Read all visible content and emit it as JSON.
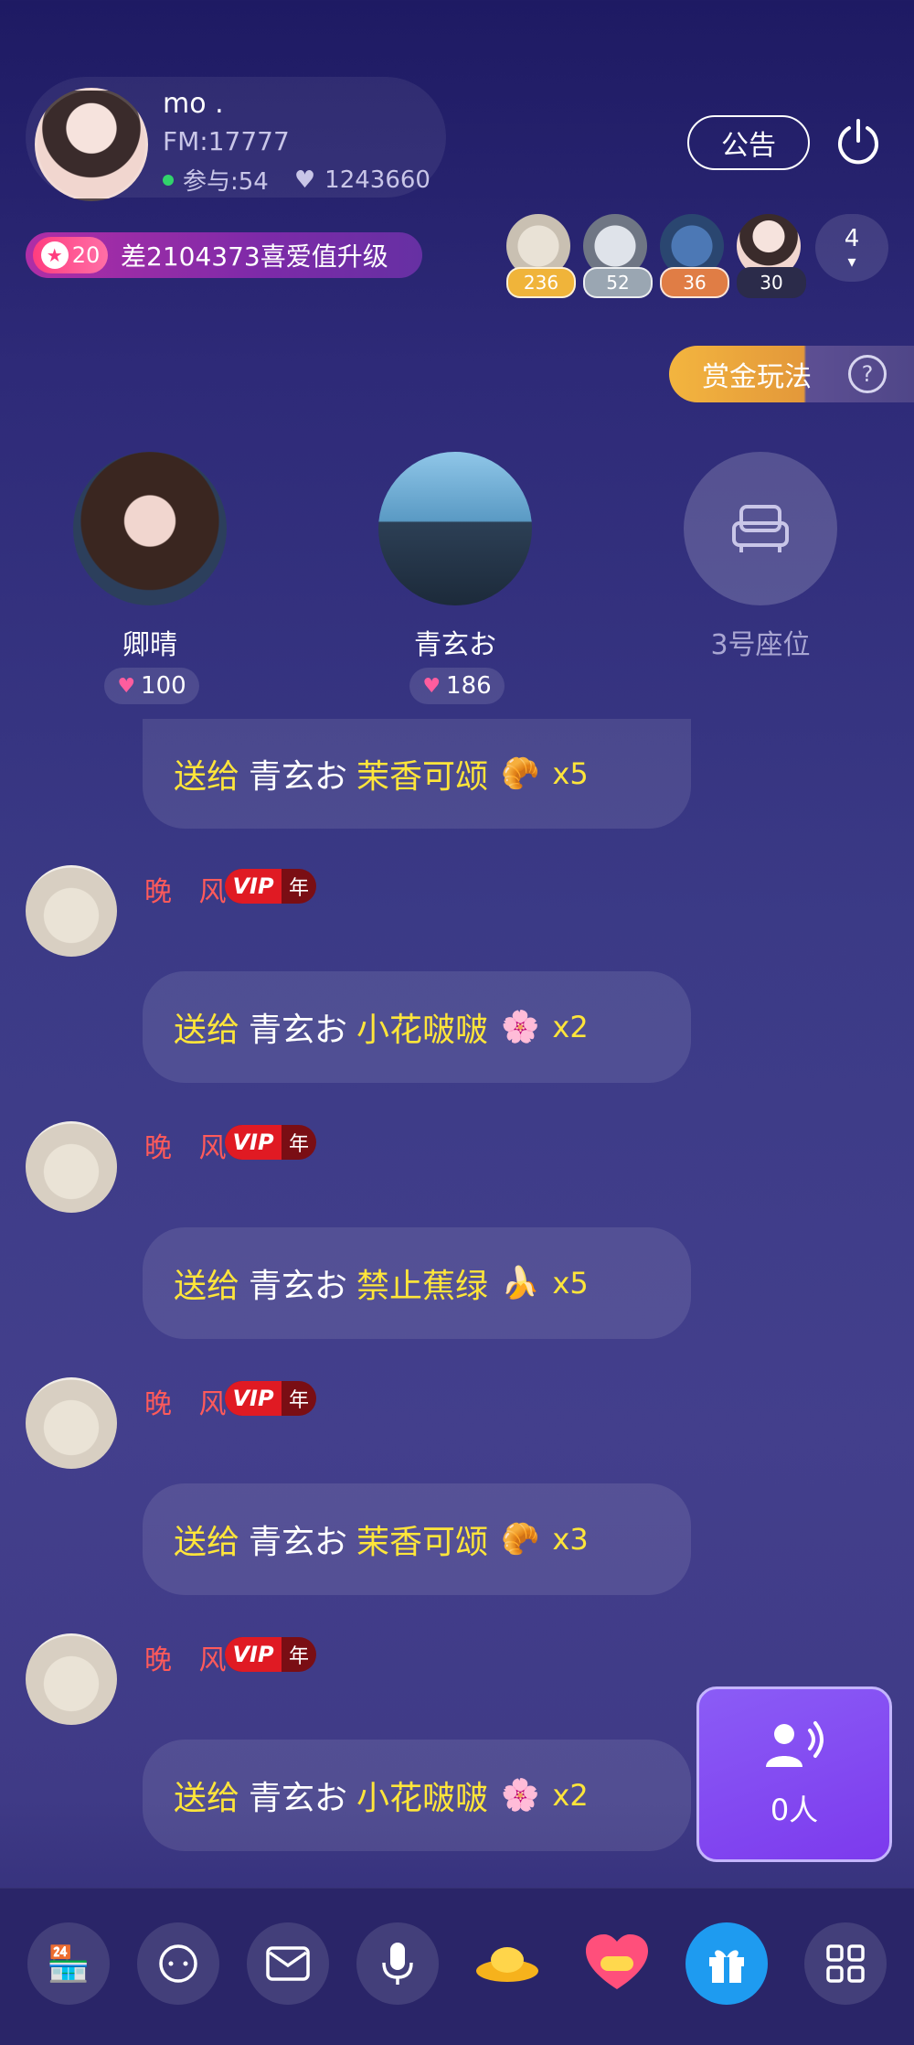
{
  "host": {
    "name": "mo .",
    "fm": "FM:17777",
    "participants": "参与:54",
    "hearts": "1243660"
  },
  "header": {
    "notice_label": "公告",
    "level": "20",
    "level_text": "差2104373喜爱值升级",
    "viewers": [
      {
        "score": "236",
        "color": "#f0b43a"
      },
      {
        "score": "52",
        "color": "#9aa6b2"
      },
      {
        "score": "36",
        "color": "#e07d45"
      },
      {
        "score": "30",
        "color": "#2b2b4a"
      }
    ],
    "more_count": "4",
    "bounty_label": "赏金玩法"
  },
  "seats": [
    {
      "name": "卿晴",
      "score": "100"
    },
    {
      "name": "青玄お",
      "score": "186"
    },
    {
      "name": "3号座位"
    }
  ],
  "chat": [
    {
      "prefix": "送给",
      "target": "青玄お",
      "gift": "茉香可颂",
      "count": "x5"
    },
    {
      "user": "晚 风",
      "vip": "VIP",
      "year": "年",
      "prefix": "送给",
      "target": "青玄お",
      "gift": "小花啵啵",
      "count": "x2"
    },
    {
      "user": "晚 风",
      "vip": "VIP",
      "year": "年",
      "prefix": "送给",
      "target": "青玄お",
      "gift": "禁止蕉绿",
      "count": "x5"
    },
    {
      "user": "晚 风",
      "vip": "VIP",
      "year": "年",
      "prefix": "送给",
      "target": "青玄お",
      "gift": "茉香可颂",
      "count": "x3"
    },
    {
      "user": "晚 风",
      "vip": "VIP",
      "year": "年",
      "prefix": "送给",
      "target": "青玄お",
      "gift": "小花啵啵",
      "count": "x2"
    }
  ],
  "listeners": {
    "label": "0人"
  },
  "icons": {
    "power": "power-icon",
    "heart": "heart-icon",
    "help": "help-icon",
    "sofa": "sofa-icon",
    "croissant": "croissant-icon",
    "flower": "flower-icon",
    "banana": "banana-icon",
    "speaker": "speaker-icon"
  },
  "toolbar": [
    "shop-icon",
    "chat-icon",
    "mail-icon",
    "mic-icon",
    "gold-ingot-icon",
    "heart-gift-icon",
    "gift-icon",
    "apps-icon"
  ]
}
